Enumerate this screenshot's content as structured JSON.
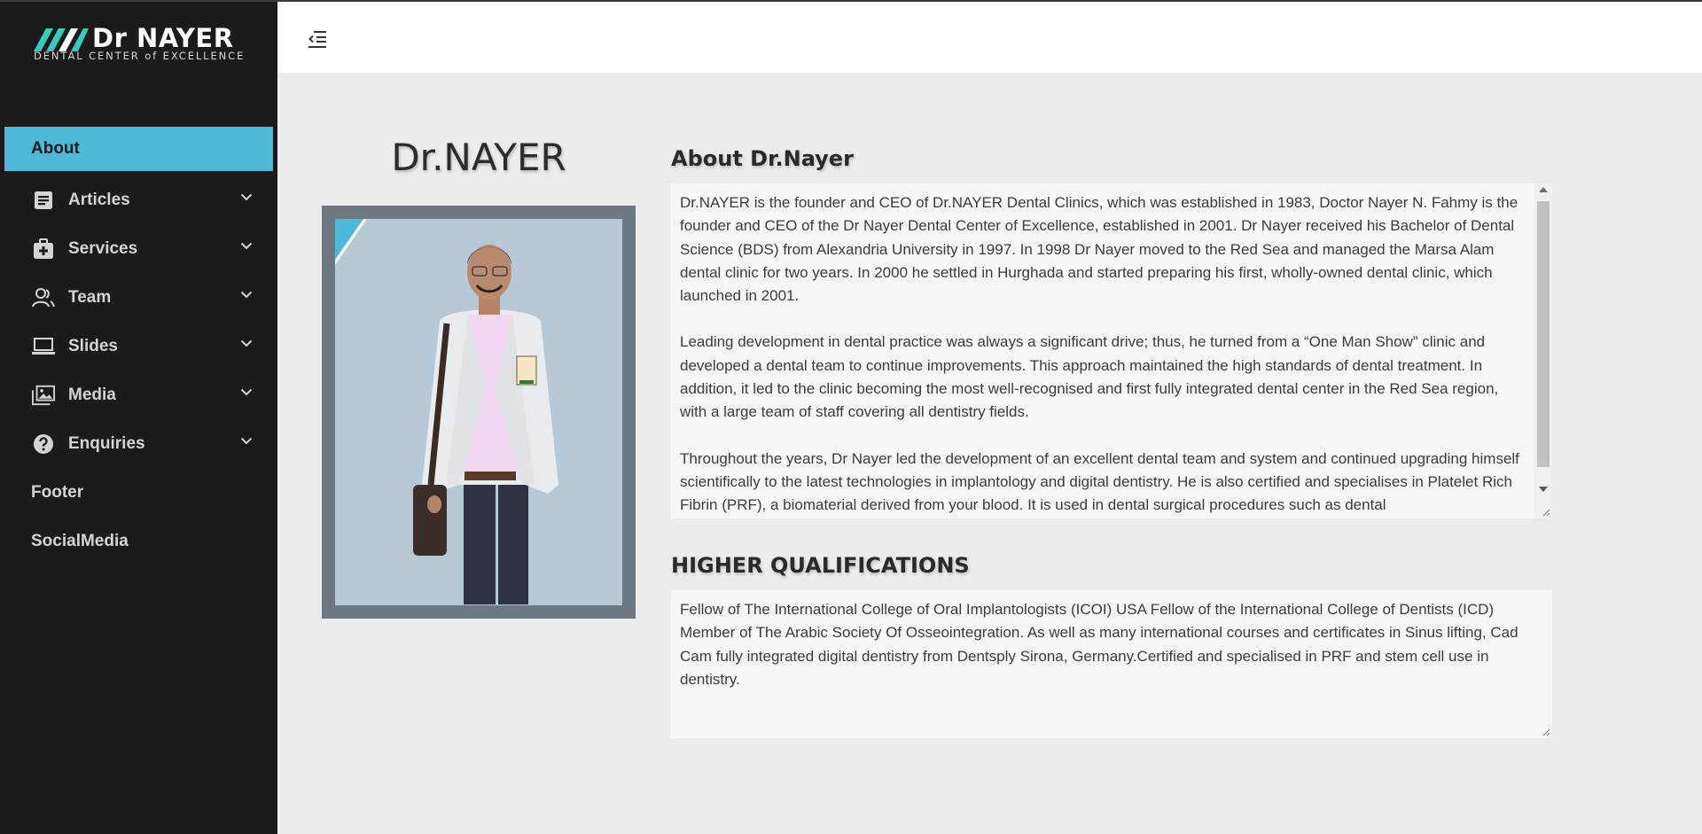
{
  "brand": {
    "title": "Dr NAYER",
    "subtitle": "DENTAL CENTER of EXCELLENCE"
  },
  "sidebar": {
    "items": [
      {
        "label": "About",
        "icon": "none",
        "active": true,
        "has_dropdown": false
      },
      {
        "label": "Articles",
        "icon": "article-icon",
        "active": false,
        "has_dropdown": true
      },
      {
        "label": "Services",
        "icon": "medical-kit-icon",
        "active": false,
        "has_dropdown": true
      },
      {
        "label": "Team",
        "icon": "users-icon",
        "active": false,
        "has_dropdown": true
      },
      {
        "label": "Slides",
        "icon": "laptop-icon",
        "active": false,
        "has_dropdown": true
      },
      {
        "label": "Media",
        "icon": "images-icon",
        "active": false,
        "has_dropdown": true
      },
      {
        "label": "Enquiries",
        "icon": "question-circle-icon",
        "active": false,
        "has_dropdown": true
      },
      {
        "label": "Footer",
        "icon": "none",
        "active": false,
        "has_dropdown": false
      },
      {
        "label": "SocialMedia",
        "icon": "none",
        "active": false,
        "has_dropdown": false
      }
    ]
  },
  "topbar": {
    "toggle_icon": "menu-collapse-icon"
  },
  "profile": {
    "name": "Dr.NAYER"
  },
  "about": {
    "title": "About Dr.Nayer",
    "paragraphs": [
      "Dr.NAYER is the founder and CEO of Dr.NAYER Dental Clinics, which was established in 1983, Doctor Nayer N. Fahmy is the founder and CEO of the Dr Nayer Dental Center of Excellence, established in 2001. Dr Nayer received his Bachelor of Dental Science (BDS) from Alexandria University in 1997. In 1998 Dr Nayer moved to the Red Sea and managed the Marsa Alam dental clinic for two years. In 2000 he settled in Hurghada and started preparing his first, wholly-owned dental clinic, which launched in 2001.",
      "Leading development in dental practice was always a significant drive; thus, he turned from a “One Man Show” clinic and developed a dental team to continue improvements. This approach maintained the high standards of dental treatment. In addition, it led to the clinic becoming the most well-recognised and first fully integrated dental center in the Red Sea region, with a large team of staff covering all dentistry fields.",
      "Throughout the years, Dr Nayer led the development of an excellent dental team and system and continued upgrading himself scientifically to the latest technologies in implantology and digital dentistry. He is also certified and specialises in Platelet Rich Fibrin (PRF), a biomaterial derived from your blood. It is used in dental surgical procedures such as dental"
    ]
  },
  "qualifications": {
    "title": "HIGHER QUALIFICATIONS",
    "text": "Fellow of The International College of Oral Implantologists (ICOI) USA Fellow of the International College of Dentists (ICD) Member of The Arabic Society Of Osseointegration. As well as many international courses and certificates in Sinus lifting, Cad Cam fully integrated digital dentistry from Dentsply Sirona, Germany.Certified and specialised in PRF and stem cell use in dentistry."
  },
  "colors": {
    "sidebar_bg": "#1b1b1b",
    "accent": "#4db8d9",
    "frame": "#6d7880",
    "logo_green": "#3ee0a0"
  }
}
